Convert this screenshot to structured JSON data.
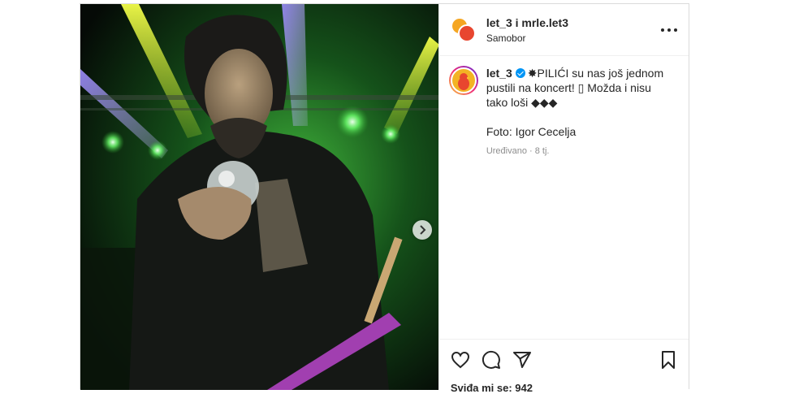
{
  "post": {
    "header": {
      "usernames": "let_3 i mrle.let3",
      "location": "Samobor"
    },
    "caption": {
      "username": "let_3",
      "text": "✸PILIĆI su nas još jednom pustili na koncert! ▯ Možda i nisu tako loši ◆◆◆",
      "credit": "Foto: Igor Cecelja",
      "meta": "Uređivano · 8 tj."
    },
    "likes_text": "Sviđa mi se: 942"
  },
  "icons": {
    "more": "more-options-icon",
    "like": "heart-icon",
    "comment": "comment-icon",
    "share": "share-icon",
    "save": "bookmark-icon",
    "next": "chevron-right-icon"
  },
  "colors": {
    "verified": "#0095f6",
    "text": "#262626",
    "meta": "#8e8e8e",
    "border": "#dbdbdb"
  }
}
